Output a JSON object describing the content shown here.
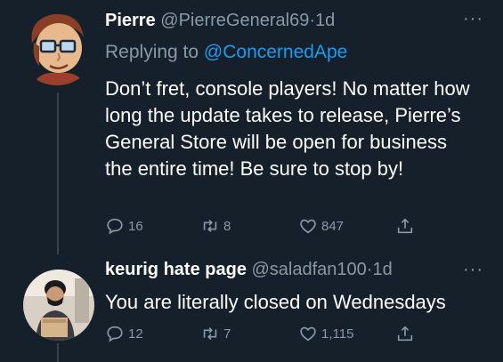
{
  "tweets": [
    {
      "name": "Pierre",
      "handle": "@PierreGeneral69",
      "separator": "·",
      "time": "1d",
      "more": "···",
      "reply_prefix": "Replying to",
      "reply_mention": "@ConcernedApe",
      "text": "Don’t fret, console players! No matter how long the update takes to release, Pierre’s General Store will be open for business the entire time! Be sure to stop by!",
      "replies": "16",
      "retweets": "8",
      "likes": "847"
    },
    {
      "name": "keurig hate page",
      "handle": "@saladfan100",
      "separator": "·",
      "time": "1d",
      "more": "···",
      "text": "You are literally closed on Wednesdays",
      "replies": "12",
      "retweets": "7",
      "likes": "1,115"
    }
  ],
  "icons": [
    "reply-icon",
    "retweet-icon",
    "like-icon",
    "share-icon"
  ],
  "colors": {
    "background": "#15202b",
    "muted": "#8b98a5",
    "link": "#1d9bf0",
    "text": "#ffffff"
  }
}
